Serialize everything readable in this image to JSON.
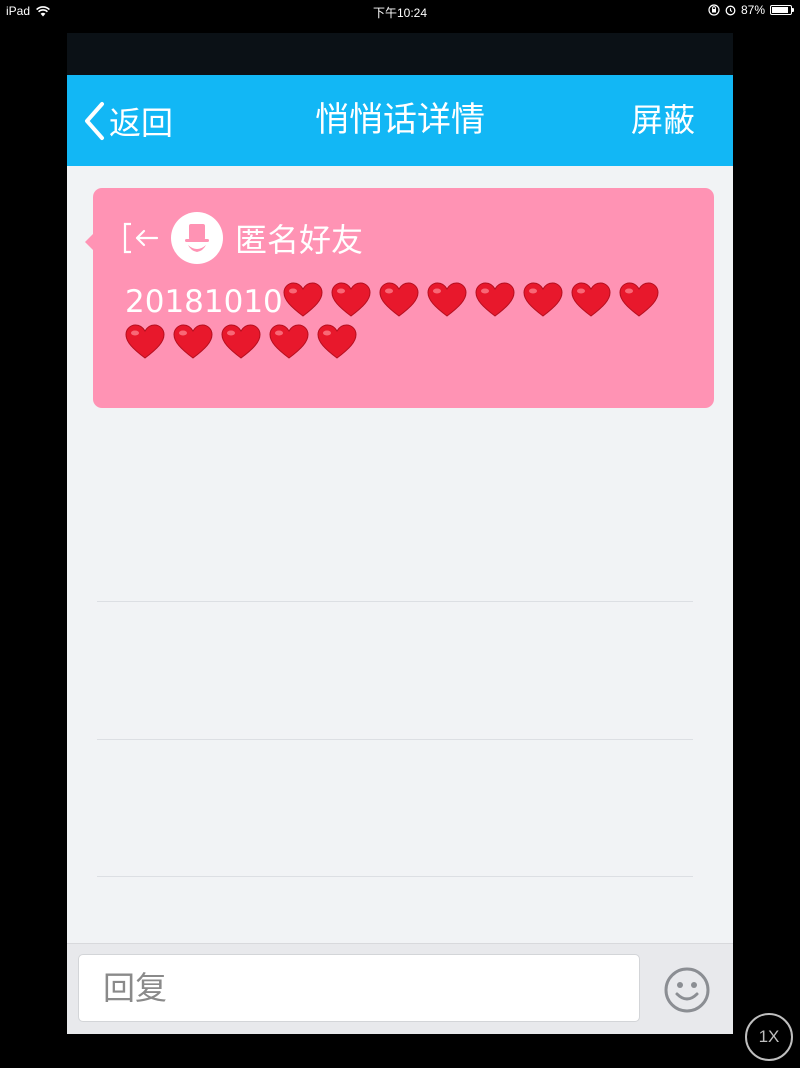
{
  "device_status": {
    "device_name": "iPad",
    "time": "下午10:24",
    "battery_percent": "87%",
    "battery_level": 0.87
  },
  "nav": {
    "back_label": "返回",
    "title": "悄悄话详情",
    "block_label": "屏蔽"
  },
  "message": {
    "sender": "匿名好友",
    "text": "20181010",
    "heart_count": 13,
    "card_color": "#ff93b4"
  },
  "reply": {
    "placeholder": "回复",
    "value": ""
  },
  "icons": {
    "back": "chevron-left-icon",
    "entry": "entry-arrow-icon",
    "avatar": "anonymous-avatar-icon",
    "heart": "red-heart-icon",
    "emoji": "smiley-icon",
    "wifi": "wifi-icon",
    "battery": "battery-icon",
    "lock": "orientation-lock-icon",
    "alarm": "alarm-icon"
  },
  "colors": {
    "nav_bar": "#12b7f5",
    "background": "#f1f3f5",
    "heart": "#e8182c"
  },
  "zoom_badge": "1X"
}
